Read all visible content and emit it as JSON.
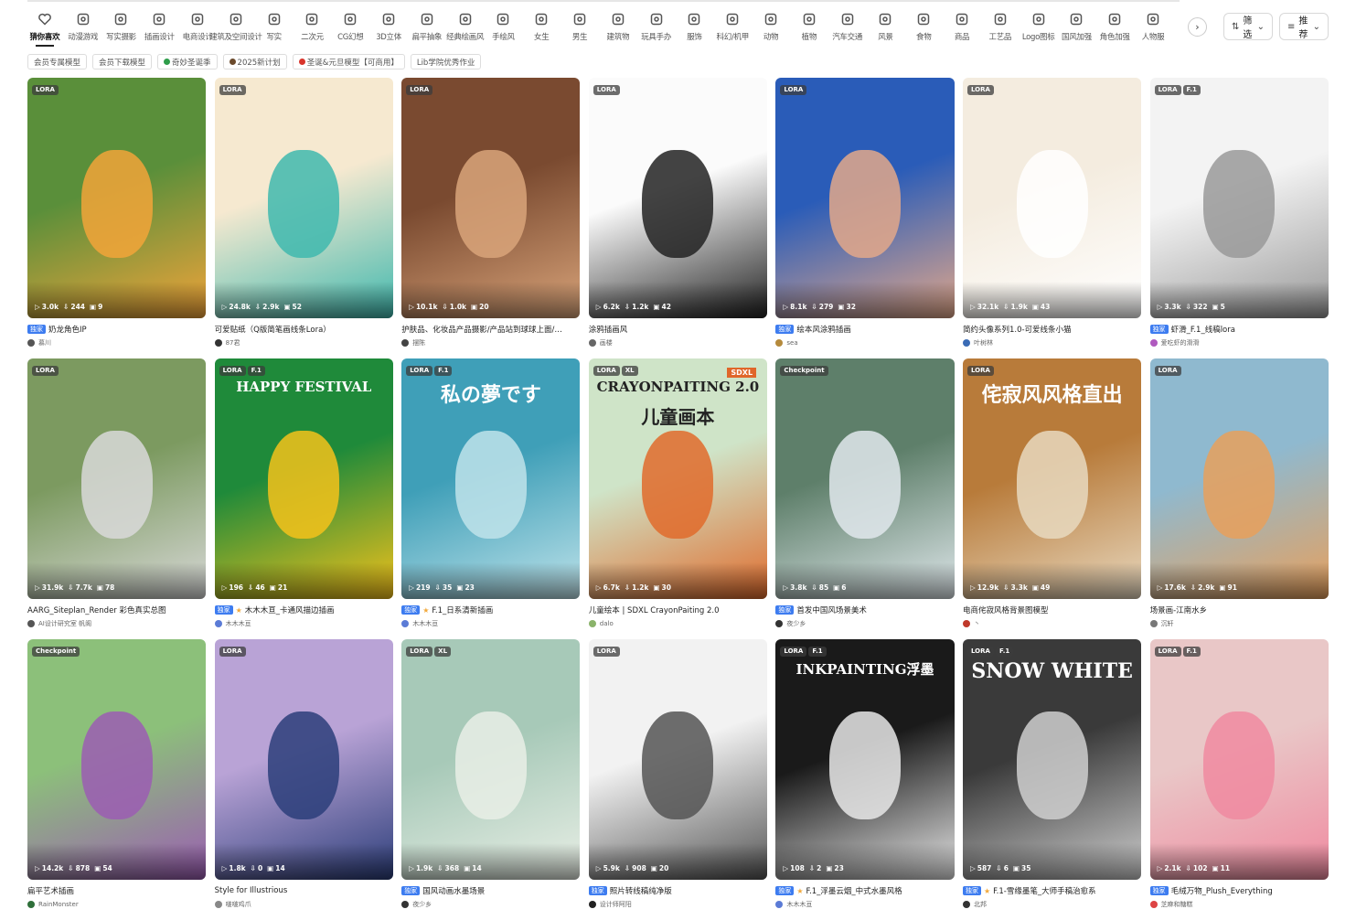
{
  "categories": [
    {
      "label": "猜你喜欢",
      "icon": "heart-icon",
      "active": true
    },
    {
      "label": "动漫游戏",
      "icon": "gamepad-icon"
    },
    {
      "label": "写实摄影",
      "icon": "camera-icon"
    },
    {
      "label": "插画设计",
      "icon": "image-icon"
    },
    {
      "label": "电商设计",
      "icon": "shopping-bag-icon"
    },
    {
      "label": "建筑及空间设计",
      "icon": "building-icon"
    },
    {
      "label": "写实",
      "icon": "pen-icon"
    },
    {
      "label": "二次元",
      "icon": "star-face-icon"
    },
    {
      "label": "CG幻想",
      "icon": "cg-icon"
    },
    {
      "label": "3D立体",
      "icon": "cube-icon"
    },
    {
      "label": "扁平抽象",
      "icon": "flat-cube-icon"
    },
    {
      "label": "经典绘画风",
      "icon": "brush-icon"
    },
    {
      "label": "手绘风",
      "icon": "pencil-icon"
    },
    {
      "label": "女生",
      "icon": "female-icon"
    },
    {
      "label": "男生",
      "icon": "male-icon"
    },
    {
      "label": "建筑物",
      "icon": "architecture-icon"
    },
    {
      "label": "玩具手办",
      "icon": "toy-icon"
    },
    {
      "label": "服饰",
      "icon": "shirt-icon"
    },
    {
      "label": "科幻/机甲",
      "icon": "robot-icon"
    },
    {
      "label": "动物",
      "icon": "paw-icon"
    },
    {
      "label": "植物",
      "icon": "plant-icon"
    },
    {
      "label": "汽车交通",
      "icon": "bus-icon"
    },
    {
      "label": "风景",
      "icon": "landscape-icon"
    },
    {
      "label": "食物",
      "icon": "food-icon"
    },
    {
      "label": "商品",
      "icon": "box-icon"
    },
    {
      "label": "工艺品",
      "icon": "gem-icon"
    },
    {
      "label": "Logo图标",
      "icon": "logo-icon"
    },
    {
      "label": "国风加强",
      "icon": "pagoda-icon"
    },
    {
      "label": "角色加强",
      "icon": "wand-icon"
    },
    {
      "label": "人物服",
      "icon": "person-icon"
    }
  ],
  "filter": {
    "label": "筛选"
  },
  "sort": {
    "label": "推荐"
  },
  "chips": [
    {
      "label": "会员专属模型",
      "dot": ""
    },
    {
      "label": "会员下载模型",
      "dot": ""
    },
    {
      "label": "奇妙圣诞季",
      "dot": "#2e9d4a"
    },
    {
      "label": "2025新计划",
      "dot": "#6b4a2c"
    },
    {
      "label": "圣诞&元旦模型【可商用】",
      "dot": "#d8342b"
    },
    {
      "label": "Lib学院优秀作业",
      "dot": ""
    }
  ],
  "cards": [
    {
      "tags": [
        "LORA"
      ],
      "views": "3.0k",
      "downloads": "244",
      "images": "9",
      "exclusive": true,
      "star": false,
      "title": "奶龙角色IP",
      "author": "慕川",
      "bg": "#5a8f3a",
      "bg2": "#f2a43a",
      "overlay": "",
      "avatar": "#555"
    },
    {
      "tags": [
        "LORA"
      ],
      "views": "24.8k",
      "downloads": "2.9k",
      "images": "52",
      "exclusive": false,
      "star": false,
      "title": "可爱贴纸（Q版简笔画线条Lora）",
      "author": "87君",
      "bg": "#f6e9d0",
      "bg2": "#3fb8ae",
      "overlay": "",
      "avatar": "#333"
    },
    {
      "tags": [
        "LORA"
      ],
      "views": "10.1k",
      "downloads": "1.0k",
      "images": "20",
      "exclusive": false,
      "star": false,
      "title": "护肤品、化妆品产品摄影/产品站到球球上面/电...",
      "author": "摆陈",
      "bg": "#7a4a30",
      "bg2": "#d9a47a",
      "overlay": "",
      "avatar": "#444"
    },
    {
      "tags": [
        "LORA"
      ],
      "views": "6.2k",
      "downloads": "1.2k",
      "images": "42",
      "exclusive": false,
      "star": false,
      "title": "涂鸦插画风",
      "author": "画楼",
      "bg": "#fbfbfb",
      "bg2": "#222222",
      "overlay": "",
      "avatar": "#666"
    },
    {
      "tags": [
        "LORA"
      ],
      "views": "8.1k",
      "downloads": "279",
      "images": "32",
      "exclusive": true,
      "star": false,
      "title": "绘本风涂鸦插画",
      "author": "sea",
      "bg": "#2a5cb8",
      "bg2": "#e3a88a",
      "overlay": "",
      "avatar": "#b58a3c"
    },
    {
      "tags": [
        "LORA"
      ],
      "views": "32.1k",
      "downloads": "1.9k",
      "images": "43",
      "exclusive": false,
      "star": false,
      "title": "简约头像系列1.0-可爱线条小猫",
      "author": "叶树林",
      "bg": "#f4ecdf",
      "bg2": "#ffffff",
      "overlay": "",
      "avatar": "#3a6bb5"
    },
    {
      "tags": [
        "LORA",
        "F.1"
      ],
      "views": "3.3k",
      "downloads": "322",
      "images": "5",
      "exclusive": true,
      "star": false,
      "title": "虾滑_F.1_线稿lora",
      "author": "爱吃虾的滑滑",
      "bg": "#f3f3f3",
      "bg2": "#999999",
      "overlay": "",
      "avatar": "#b05abf"
    },
    {
      "tags": [
        "LORA"
      ],
      "views": "31.9k",
      "downloads": "7.7k",
      "images": "78",
      "exclusive": false,
      "star": false,
      "title": "AARG_Siteplan_Render 彩色真实总图",
      "author": "AI设计研究室 帆阁",
      "bg": "#7c9a60",
      "bg2": "#d9d9d9",
      "overlay": "",
      "avatar": "#555"
    },
    {
      "tags": [
        "LORA",
        "F.1"
      ],
      "views": "196",
      "downloads": "46",
      "images": "21",
      "exclusive": true,
      "star": true,
      "title": "木木木亘_卡通风描边插画",
      "author": "木木木亘",
      "bg": "#1f8a3a",
      "bg2": "#f5c21b",
      "overlay": "HAPPY FESTIVAL",
      "avatar": "#5b7bd6"
    },
    {
      "tags": [
        "LORA",
        "F.1"
      ],
      "views": "219",
      "downloads": "35",
      "images": "23",
      "exclusive": true,
      "star": true,
      "title": "F.1_日系清新插画",
      "author": "木木木亘",
      "bg": "#3f9fb8",
      "bg2": "#bfe3ea",
      "overlay": "私の夢です",
      "avatar": "#5b7bd6"
    },
    {
      "tags": [
        "LORA",
        "XL"
      ],
      "views": "6.7k",
      "downloads": "1.2k",
      "images": "30",
      "exclusive": false,
      "star": false,
      "title": "儿童绘本 | SDXL CrayonPaiting 2.0",
      "author": "dalo",
      "bg": "#cfe4c8",
      "bg2": "#e06b2c",
      "overlay": "CRAYONPAITING 2.0",
      "overlay2": "儿童画本",
      "badge": "SDXL",
      "avatar": "#8ab36a"
    },
    {
      "tags": [
        "Checkpoint"
      ],
      "views": "3.8k",
      "downloads": "85",
      "images": "6",
      "exclusive": true,
      "star": false,
      "title": "首发中国风场景美术",
      "author": "夜少乡",
      "bg": "#5e7f6a",
      "bg2": "#e0e8ec",
      "overlay": "",
      "avatar": "#333"
    },
    {
      "tags": [
        "LORA"
      ],
      "views": "12.9k",
      "downloads": "3.3k",
      "images": "49",
      "exclusive": false,
      "star": false,
      "title": "电商侘寂风格背景图模型",
      "author": "丶",
      "bg": "#b87b3a",
      "bg2": "#e8d9c0",
      "overlay": "侘寂风风格直出",
      "avatar": "#c0392b"
    },
    {
      "tags": [
        "LORA"
      ],
      "views": "17.6k",
      "downloads": "2.9k",
      "images": "91",
      "exclusive": false,
      "star": false,
      "title": "场景画-江南水乡",
      "author": "沉轩",
      "bg": "#8fb9cf",
      "bg2": "#e8a05c",
      "overlay": "",
      "avatar": "#777"
    },
    {
      "tags": [
        "Checkpoint"
      ],
      "views": "14.2k",
      "downloads": "878",
      "images": "54",
      "exclusive": false,
      "star": false,
      "title": "扁平艺术插画",
      "author": "RainMonster",
      "bg": "#8cc07a",
      "bg2": "#9b5db3",
      "overlay": "",
      "avatar": "#2f6f3a"
    },
    {
      "tags": [
        "LORA"
      ],
      "views": "1.8k",
      "downloads": "0",
      "images": "14",
      "exclusive": false,
      "star": false,
      "title": "Style for Illustrious",
      "author": "啵啵鸡爪",
      "bg": "#b9a3d6",
      "bg2": "#2c3e7a",
      "overlay": "",
      "avatar": "#888"
    },
    {
      "tags": [
        "LORA",
        "XL"
      ],
      "views": "1.9k",
      "downloads": "368",
      "images": "14",
      "exclusive": true,
      "star": false,
      "title": "国风动画水墨场景",
      "author": "夜少乡",
      "bg": "#a7c9b8",
      "bg2": "#e9efe6",
      "overlay": "",
      "avatar": "#333"
    },
    {
      "tags": [
        "LORA"
      ],
      "views": "5.9k",
      "downloads": "908",
      "images": "20",
      "exclusive": true,
      "star": false,
      "title": "照片转线稿纯净版",
      "author": "设计师阿阳",
      "bg": "#f2f2f2",
      "bg2": "#555555",
      "overlay": "",
      "avatar": "#222"
    },
    {
      "tags": [
        "LORA",
        "F.1"
      ],
      "views": "108",
      "downloads": "2",
      "images": "23",
      "exclusive": true,
      "star": true,
      "title": "F.1_浮墨云烟_中式水墨风格",
      "author": "木木木亘",
      "bg": "#1a1a1a",
      "bg2": "#e8e8e8",
      "overlay": "INKPAINTING浮墨",
      "avatar": "#5b7bd6"
    },
    {
      "tags": [
        "LORA",
        "F.1"
      ],
      "views": "587",
      "downloads": "6",
      "images": "35",
      "exclusive": true,
      "star": true,
      "title": "F.1-雪缘墨笔_大师手稿治愈系",
      "author": "北邦",
      "bg": "#3a3a3a",
      "bg2": "#cfcfcf",
      "overlay": "SNOW WHITE",
      "avatar": "#333"
    },
    {
      "tags": [
        "LORA",
        "F.1"
      ],
      "views": "2.1k",
      "downloads": "102",
      "images": "11",
      "exclusive": true,
      "star": false,
      "title": "毛绒万物_Plush_Everything",
      "author": "芝麻和糖糕",
      "bg": "#e9c7c7",
      "bg2": "#f08aa0",
      "overlay": "",
      "avatar": "#d44"
    }
  ]
}
